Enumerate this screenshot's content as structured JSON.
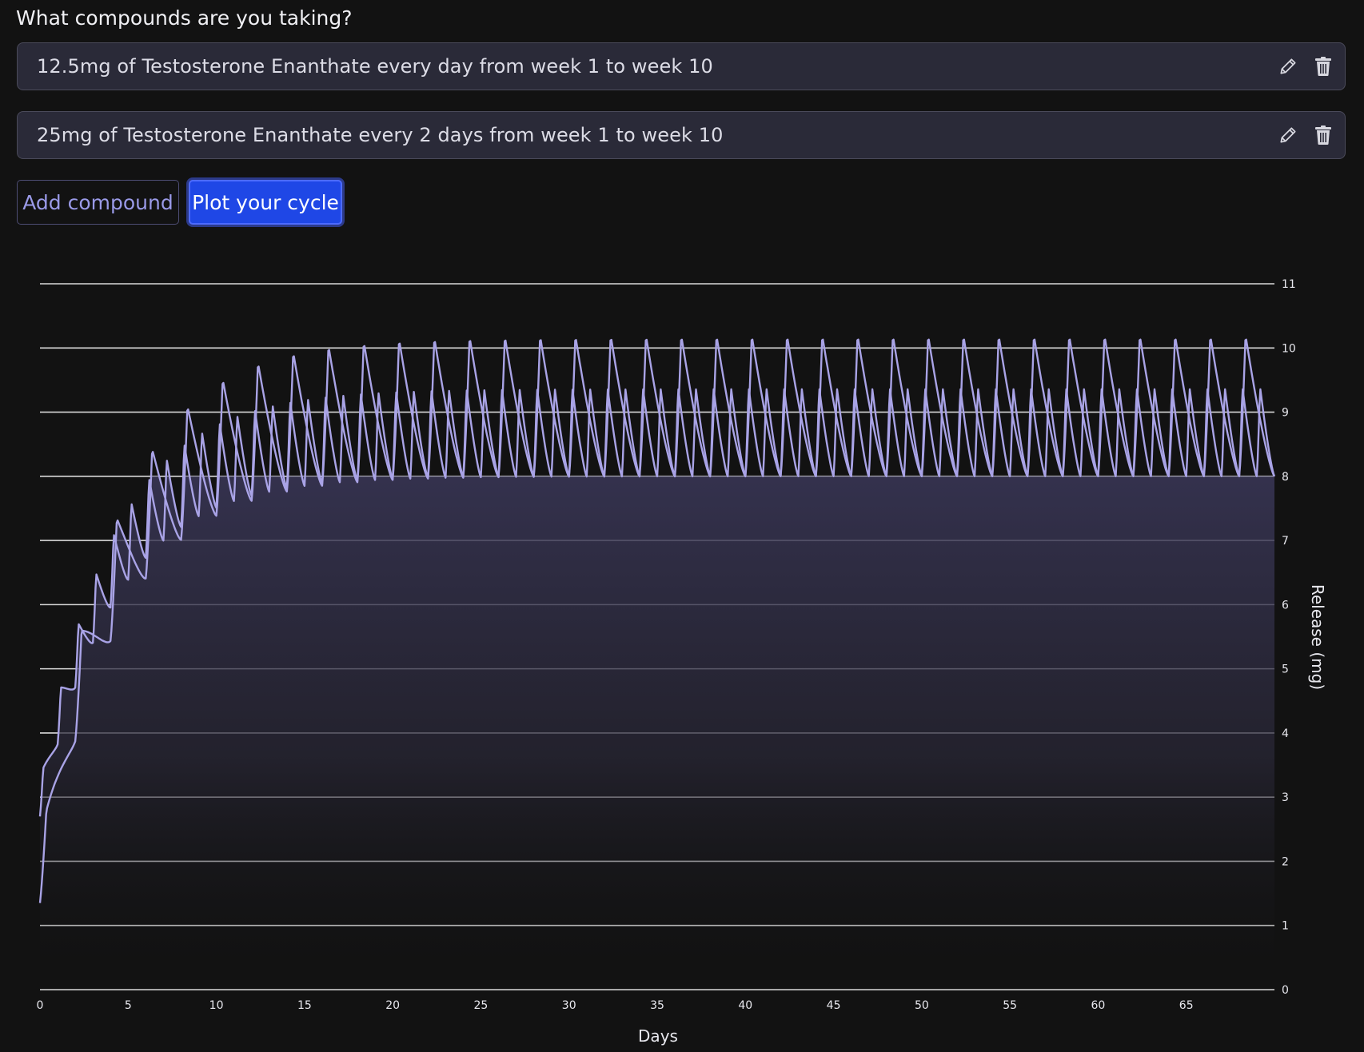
{
  "question": "What compounds are you taking?",
  "compounds": [
    {
      "label": "12.5mg of Testosterone Enanthate every day from week 1 to week 10",
      "edit_icon": "pencil-icon",
      "delete_icon": "trash-icon"
    },
    {
      "label": "25mg of Testosterone Enanthate every 2 days from week 1 to week 10",
      "edit_icon": "pencil-icon",
      "delete_icon": "trash-icon"
    }
  ],
  "buttons": {
    "add_compound": "Add compound",
    "plot_cycle": "Plot your cycle"
  },
  "colors": {
    "background": "#121212",
    "line": "#a9a3e6",
    "primary_button": "#1f47e6",
    "input_bg": "#2a2a38"
  },
  "chart_data": {
    "type": "area",
    "xlabel": "Days",
    "ylabel": "Release (mg)",
    "xlim": [
      0,
      70
    ],
    "ylim": [
      0,
      11
    ],
    "x_ticks": [
      0,
      5,
      10,
      15,
      20,
      25,
      30,
      35,
      40,
      45,
      50,
      55,
      60,
      65
    ],
    "y_ticks": [
      0,
      1,
      2,
      3,
      4,
      5,
      6,
      7,
      8,
      9,
      10,
      11
    ],
    "y_axis_position": "right",
    "grid": "horizontal",
    "series": [
      {
        "dose_mg": 12.5,
        "interval_days": 1,
        "start_day": 0,
        "end_day": 70,
        "steady_state_min": 8.0,
        "steady_state_max": 9.4,
        "start_value": 2.7
      },
      {
        "dose_mg": 25,
        "interval_days": 2,
        "start_day": 0,
        "end_day": 70,
        "steady_state_min": 8.0,
        "steady_state_max": 10.2,
        "start_value": 1.35
      }
    ]
  }
}
